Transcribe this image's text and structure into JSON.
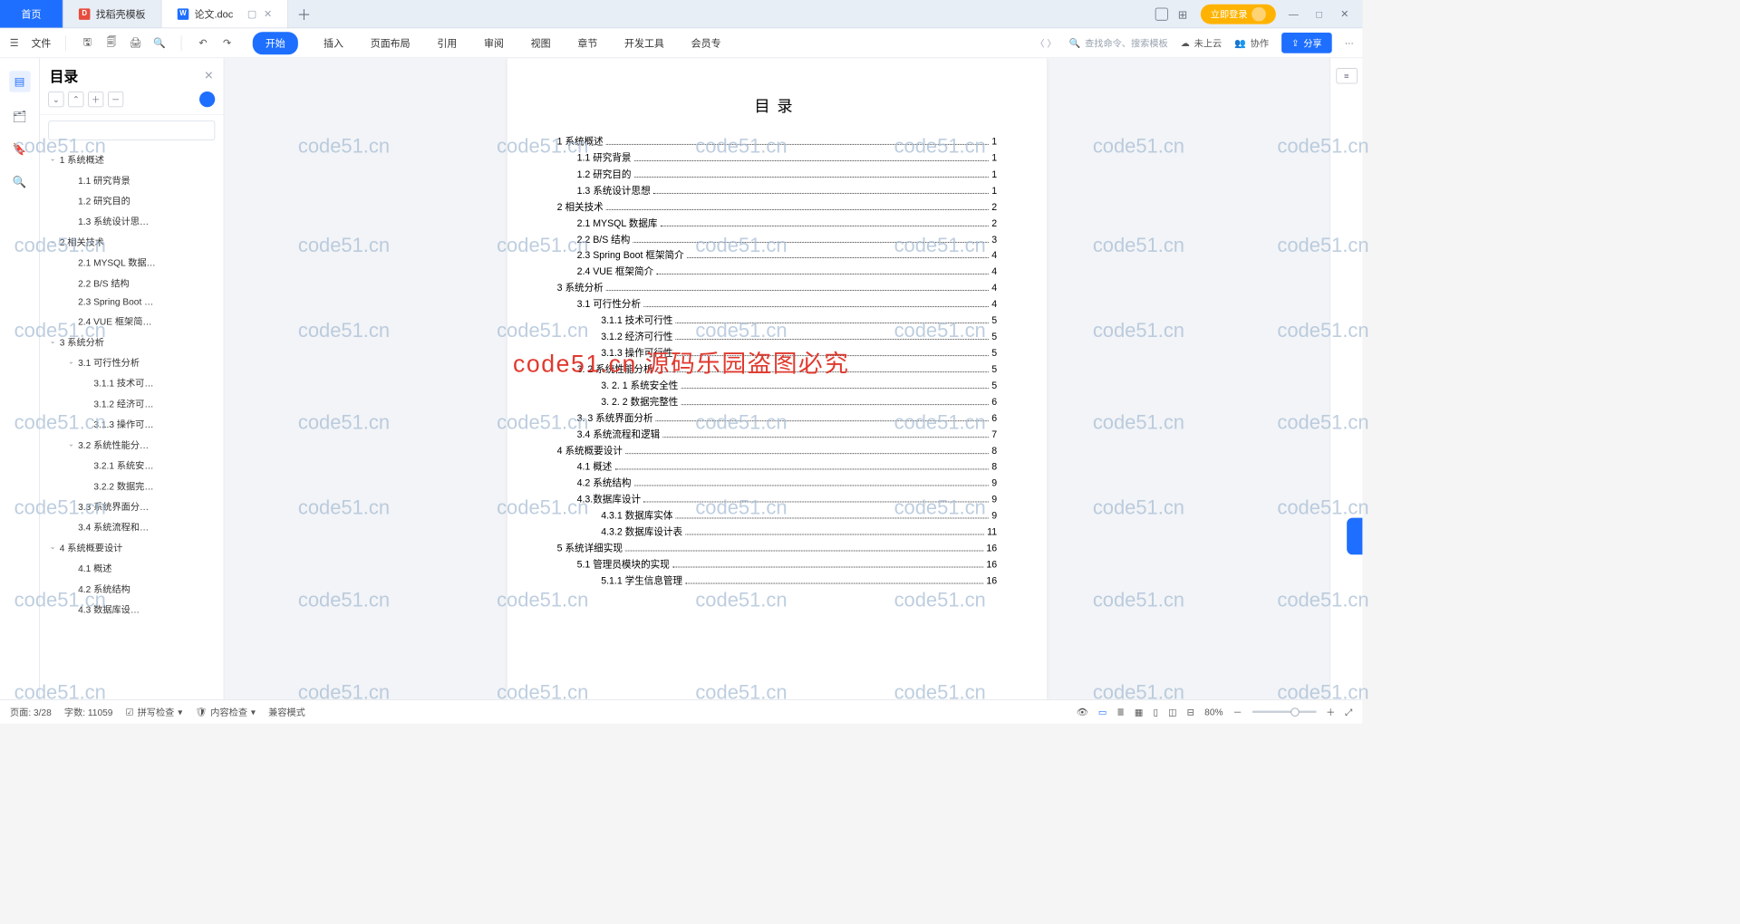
{
  "tabs": {
    "home": "首页",
    "t1": "找稻壳模板",
    "t2": "论文.doc",
    "login": "立即登录"
  },
  "ribbon": {
    "file": "文件",
    "menus": [
      "开始",
      "插入",
      "页面布局",
      "引用",
      "审阅",
      "视图",
      "章节",
      "开发工具",
      "会员专"
    ],
    "search_ph": "查找命令、搜索模板",
    "cloud": "未上云",
    "collab": "协作",
    "share": "分享"
  },
  "outline": {
    "title": "目录",
    "items": [
      {
        "l": 1,
        "t": "1 系统概述",
        "c": true
      },
      {
        "l": 2,
        "t": "1.1 研究背景"
      },
      {
        "l": 2,
        "t": "1.2 研究目的"
      },
      {
        "l": 2,
        "t": "1.3 系统设计思…"
      },
      {
        "l": 1,
        "t": "2 相关技术",
        "c": true
      },
      {
        "l": 2,
        "t": "2.1 MYSQL 数据…"
      },
      {
        "l": 2,
        "t": "2.2 B/S 结构"
      },
      {
        "l": 2,
        "t": "2.3 Spring Boot …"
      },
      {
        "l": 2,
        "t": "2.4 VUE 框架简…"
      },
      {
        "l": 1,
        "t": "3 系统分析",
        "c": true
      },
      {
        "l": 2,
        "t": "3.1 可行性分析",
        "c": true
      },
      {
        "l": 3,
        "t": "3.1.1 技术可…"
      },
      {
        "l": 3,
        "t": "3.1.2 经济可…"
      },
      {
        "l": 3,
        "t": "3.1.3 操作可…"
      },
      {
        "l": 2,
        "t": "3.2 系统性能分…",
        "c": true
      },
      {
        "l": 3,
        "t": "3.2.1 系统安…"
      },
      {
        "l": 3,
        "t": "3.2.2 数据完…"
      },
      {
        "l": 2,
        "t": "3.3 系统界面分…"
      },
      {
        "l": 2,
        "t": "3.4 系统流程和…"
      },
      {
        "l": 1,
        "t": "4 系统概要设计",
        "c": true
      },
      {
        "l": 2,
        "t": "4.1 概述"
      },
      {
        "l": 2,
        "t": "4.2 系统结构"
      },
      {
        "l": 2,
        "t": "4.3 数据库设…"
      }
    ]
  },
  "doc": {
    "title": "目录",
    "toc": [
      {
        "l": 1,
        "t": "1 系统概述",
        "p": "1"
      },
      {
        "l": 2,
        "t": "1.1 研究背景",
        "p": "1"
      },
      {
        "l": 2,
        "t": "1.2 研究目的",
        "p": "1"
      },
      {
        "l": 2,
        "t": "1.3 系统设计思想",
        "p": "1"
      },
      {
        "l": 1,
        "t": "2 相关技术",
        "p": "2"
      },
      {
        "l": 2,
        "t": "2.1 MYSQL 数据库",
        "p": "2"
      },
      {
        "l": 2,
        "t": "2.2 B/S 结构",
        "p": "3"
      },
      {
        "l": 2,
        "t": "2.3 Spring Boot 框架简介",
        "p": "4"
      },
      {
        "l": 2,
        "t": "2.4 VUE 框架简介",
        "p": "4"
      },
      {
        "l": 1,
        "t": "3 系统分析",
        "p": "4"
      },
      {
        "l": 2,
        "t": "3.1 可行性分析",
        "p": "4"
      },
      {
        "l": 3,
        "t": "3.1.1 技术可行性",
        "p": "5"
      },
      {
        "l": 3,
        "t": "3.1.2 经济可行性",
        "p": "5"
      },
      {
        "l": 3,
        "t": "3.1.3 操作可行性",
        "p": "5"
      },
      {
        "l": 2,
        "t": "3. 2 系统性能分析",
        "p": "5"
      },
      {
        "l": 3,
        "t": "3. 2. 1  系统安全性",
        "p": "5"
      },
      {
        "l": 3,
        "t": "3. 2. 2  数据完整性",
        "p": "6"
      },
      {
        "l": 2,
        "t": "3. 3 系统界面分析",
        "p": "6"
      },
      {
        "l": 2,
        "t": "3.4 系统流程和逻辑",
        "p": "7"
      },
      {
        "l": 1,
        "t": "4 系统概要设计",
        "p": "8"
      },
      {
        "l": 2,
        "t": "4.1 概述",
        "p": "8"
      },
      {
        "l": 2,
        "t": "4.2 系统结构",
        "p": "9"
      },
      {
        "l": 2,
        "t": "4.3.数据库设计",
        "p": "9"
      },
      {
        "l": 3,
        "t": "4.3.1 数据库实体",
        "p": "9"
      },
      {
        "l": 3,
        "t": "4.3.2 数据库设计表",
        "p": "11"
      },
      {
        "l": 1,
        "t": "5 系统详细实现",
        "p": "16"
      },
      {
        "l": 2,
        "t": "5.1 管理员模块的实现",
        "p": "16"
      },
      {
        "l": 3,
        "t": "5.1.1 学生信息管理",
        "p": "16"
      }
    ]
  },
  "status": {
    "page": "页面: 3/28",
    "words": "字数: 11059",
    "spell": "拼写检查",
    "content": "内容检查",
    "compat": "兼容模式",
    "zoom": "80%"
  },
  "watermark": "code51.cn",
  "watermark_red": "code51.cn 源码乐园盗图必究"
}
